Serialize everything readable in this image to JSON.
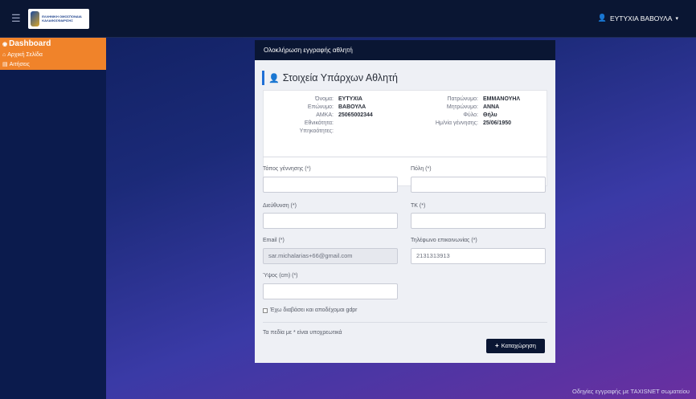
{
  "topbar": {
    "logo_text": "ΕΛΛΗΝΙΚΗ ΟΜΟΣΠΟΝΔΙΑ ΚΑΛΑΘΟΣΦΑΙΡΙΣΗΣ",
    "user_name": "ΕΥΤΥΧΙΑ ΒΑΒΟΥΛΑ",
    "caret": "▾"
  },
  "sidebar": {
    "title": "Dashboard",
    "items": [
      {
        "label": "Αρχική Σελίδα",
        "icon": "home-icon"
      },
      {
        "label": "Αιτήσεις",
        "icon": "list-icon"
      }
    ]
  },
  "panel": {
    "header": "Ολοκλήρωση εγγραφής αθλητή",
    "section_title": "Στοιχεία Υπάρχων Αθλητή",
    "info_left": [
      {
        "label": "Όνομα:",
        "value": "ΕΥΤΥΧΙΑ"
      },
      {
        "label": "Επώνυμο:",
        "value": "ΒΑΒΟΥΛΑ"
      },
      {
        "label": "ΑΜΚΑ:",
        "value": "25065002344"
      },
      {
        "label": "Εθνικότητα:",
        "value": ""
      },
      {
        "label": "Υπηκοότητες:",
        "value": ""
      }
    ],
    "info_right": [
      {
        "label": "Πατρώνυμο:",
        "value": "ΕΜΜΑΝΟΥΗΛ"
      },
      {
        "label": "Μητρώνυμο:",
        "value": "ΑΝΝΑ"
      },
      {
        "label": "Φύλο:",
        "value": "Θήλυ"
      },
      {
        "label": "Ημ/νία γέννησης:",
        "value": "25/06/1950"
      }
    ]
  },
  "form": {
    "birthplace_label": "Τόπος γέννησης (*)",
    "city_label": "Πόλη (*)",
    "address_label": "Διεύθυνση (*)",
    "zip_label": "ΤΚ (*)",
    "email_label": "Email (*)",
    "email_value": "sar.michalarias+66@gmail.com",
    "phone_label": "Τηλέφωνο επικοινωνίας (*)",
    "phone_value": "2131313913",
    "height_label": "Ύψος (cm) (*)",
    "gdpr_label": "Έχω διαβάσει και αποδέχομαι gdpr",
    "required_note": "Τα πεδία με * είναι υποχρεωτικά",
    "save_label": "Καταχώρηση",
    "save_icon": "+"
  },
  "footer": {
    "text": "Οδηγίες εγγραφής με TAXISNET σωματείου"
  },
  "colors": {
    "topbar": "#0a1633",
    "sidebar_accent": "#f0832a",
    "title_bar": "#1f6fd6"
  }
}
